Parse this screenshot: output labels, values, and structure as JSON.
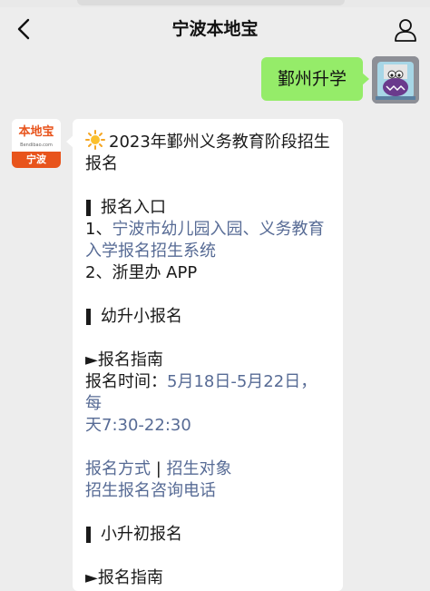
{
  "header": {
    "title": "宁波本地宝",
    "back_icon": "chevron-left-icon",
    "user_icon": "user-icon"
  },
  "messages": {
    "sent": {
      "text": "鄞州升学"
    },
    "bot": {
      "avatar": {
        "top_text": "本地宝",
        "sub_text": "Bendibao.com",
        "bar_text": "宁波"
      },
      "heading_emoji": "sun-icon",
      "heading_line1": "2023年鄞州义务教育阶段招生",
      "heading_line2": "报名",
      "section1_title": "报名入口",
      "entry1_prefix": "1、",
      "entry1_link_a": "宁波市幼儿园入园、义务教育",
      "entry1_link_b": "入学报名招生系统",
      "entry2": "2、浙里办 APP",
      "section2_title": "幼升小报名",
      "guide_title": "►报名指南",
      "time_line1_label": "报名时间：",
      "time_line1_value": "5月18日-5月22日，每",
      "time_line2": "天7:30-22:30",
      "link_method": "报名方式",
      "link_sep": "|",
      "link_target": "招生对象",
      "link_phone": "招生报名咨询电话",
      "section3_title": "小升初报名",
      "guide_title2": "►报名指南"
    }
  },
  "colors": {
    "sent_bubble": "#95ec69",
    "link": "#576b95",
    "brand_orange": "#e8541c",
    "background": "#ededed"
  }
}
